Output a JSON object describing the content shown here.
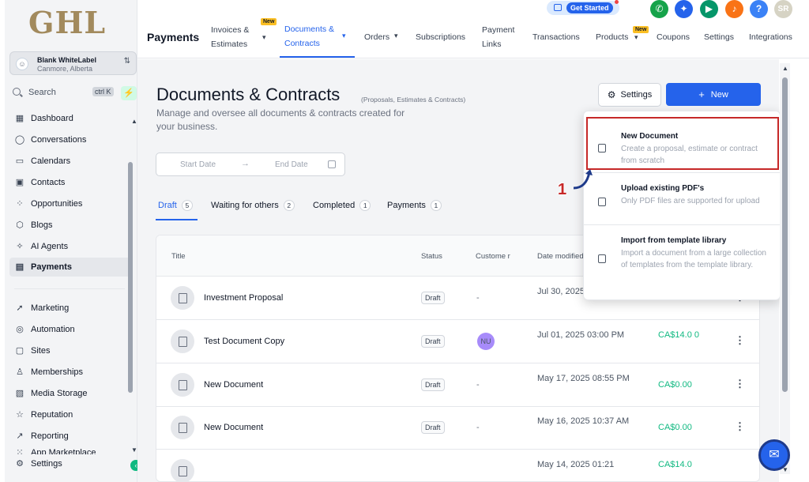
{
  "brand": {
    "logo": "GHL"
  },
  "location": {
    "name": "Blank WhiteLabel",
    "city": "Canmore, Alberta",
    "avatar_glyph": "☺"
  },
  "search": {
    "label": "Search",
    "shortcut": "ctrl K"
  },
  "sidebar": {
    "items": [
      {
        "label": "Dashboard",
        "icon": "dashboard-icon",
        "glyph": "▦"
      },
      {
        "label": "Conversations",
        "icon": "chat-icon",
        "glyph": "◯"
      },
      {
        "label": "Calendars",
        "icon": "calendar-icon",
        "glyph": "▭"
      },
      {
        "label": "Contacts",
        "icon": "contacts-icon",
        "glyph": "▣"
      },
      {
        "label": "Opportunities",
        "icon": "opportunities-icon",
        "glyph": "⁘"
      },
      {
        "label": "Blogs",
        "icon": "blogs-icon",
        "glyph": "⬡"
      },
      {
        "label": "AI Agents",
        "icon": "sparkle-icon",
        "glyph": "✧"
      },
      {
        "label": "Payments",
        "icon": "payments-icon",
        "glyph": "▤"
      },
      {
        "label": "Marketing",
        "icon": "marketing-icon",
        "glyph": "➚"
      },
      {
        "label": "Automation",
        "icon": "automation-icon",
        "glyph": "◎"
      },
      {
        "label": "Sites",
        "icon": "sites-icon",
        "glyph": "▢"
      },
      {
        "label": "Memberships",
        "icon": "memberships-icon",
        "glyph": "♙"
      },
      {
        "label": "Media Storage",
        "icon": "media-icon",
        "glyph": "▧"
      },
      {
        "label": "Reputation",
        "icon": "star-icon",
        "glyph": "☆"
      },
      {
        "label": "Reporting",
        "icon": "reporting-icon",
        "glyph": "↗"
      },
      {
        "label": "App Marketplace",
        "icon": "marketplace-icon",
        "glyph": "⁙"
      },
      {
        "label": "Settings",
        "icon": "gear-icon",
        "glyph": "⚙"
      }
    ]
  },
  "topbar": {
    "title": "Payments",
    "tabs": [
      {
        "label": "Invoices & Estimates",
        "line1": "Invoices &",
        "line2": "Estimates"
      },
      {
        "label": "Documents & Contracts",
        "line1": "Documents &",
        "line2": "Contracts"
      },
      {
        "label": "Orders"
      },
      {
        "label": "Subscriptions"
      },
      {
        "label": "Payment Links",
        "line1": "Payment",
        "line2": "Links"
      },
      {
        "label": "Transactions"
      },
      {
        "label": "Products"
      },
      {
        "label": "Coupons"
      },
      {
        "label": "Settings"
      },
      {
        "label": "Integrations"
      }
    ],
    "new_badge": "New",
    "get_started": "Get Started",
    "user_initials": "SR",
    "help": "?",
    "glyphs": {
      "phone": "✆",
      "magic": "✦",
      "megaphone": "▶",
      "bell": "♪"
    }
  },
  "page": {
    "title": "Documents & Contracts",
    "subtitle": "(Proposals, Estimates & Contracts)",
    "description": "Manage and oversee all documents & contracts created for your business.",
    "settings_button": "Settings",
    "new_button": "New",
    "date_start": "Start Date",
    "date_end": "End Date"
  },
  "tabs": [
    {
      "label": "Draft",
      "count": "5"
    },
    {
      "label": "Waiting for others",
      "count": "2"
    },
    {
      "label": "Completed",
      "count": "1"
    },
    {
      "label": "Payments",
      "count": "1"
    }
  ],
  "table": {
    "columns": {
      "title": "Title",
      "status": "Status",
      "customer": "Custome r",
      "date": "Date modified"
    },
    "rows": [
      {
        "title": "Investment Proposal",
        "status": "Draft",
        "customer": "-",
        "date": "Jul 30, 2025 PM",
        "amount": ""
      },
      {
        "title": "Test Document Copy",
        "status": "Draft",
        "customer": "NU",
        "date": "Jul 01, 2025 03:00 PM",
        "amount": "CA$14.0 0"
      },
      {
        "title": "New Document",
        "status": "Draft",
        "customer": "-",
        "date": "May 17, 2025 08:55 PM",
        "amount": "CA$0.00"
      },
      {
        "title": "New Document",
        "status": "Draft",
        "customer": "-",
        "date": "May 16, 2025 10:37 AM",
        "amount": "CA$0.00"
      },
      {
        "title": "",
        "status": "",
        "customer": "",
        "date": "May 14, 2025 01:21",
        "amount": "CA$14.0"
      }
    ]
  },
  "dropdown": {
    "items": [
      {
        "title": "New Document",
        "desc": "Create a proposal, estimate or contract from scratch"
      },
      {
        "title": "Upload existing PDF's",
        "desc": "Only PDF files are supported for upload"
      },
      {
        "title": "Import from template library",
        "desc": "Import a document from a large collection of templates from the template library."
      }
    ]
  },
  "annotation": {
    "step": "1"
  },
  "colors": {
    "accent": "#2563eb",
    "highlight": "#c62828",
    "success": "#10b981"
  }
}
